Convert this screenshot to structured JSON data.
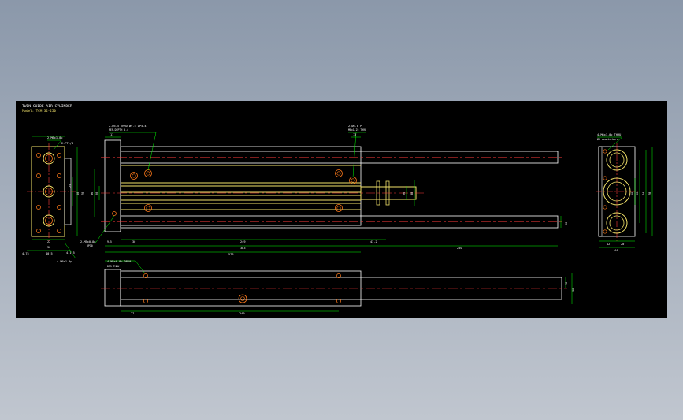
{
  "title_block": {
    "line1": "TWIN GUIDE AIR CYLINDER",
    "line2": "Model: TCM 32-250"
  },
  "colors": {
    "background": "#000000",
    "outline": "#ffffff",
    "body": "#f2e26a",
    "dimension": "#00ff00",
    "centerline": "#ff3b3b",
    "leader": "#00ff00",
    "hole": "#ff7a1a"
  },
  "left_view": {
    "top_callout": "2-M6x1.0p",
    "dims": [
      "22",
      "30",
      "40.5",
      "4-1.5",
      "50",
      "25",
      "70",
      "2-PT1/8",
      "4-M6x1.0p"
    ],
    "bottom_left": "4.75",
    "bottom_callout": "4-M6x1.0p"
  },
  "front_view": {
    "top_dims": [
      "17",
      "13"
    ],
    "left_callout_1": "2-Ø5.5 THRU Ø9.5 DP5.4",
    "left_callout_2": "REF.DEPTH 5.4",
    "right_callout_1": "2-Ø6.8 P",
    "right_callout_2": "M8x1.25 THRU",
    "side_dims": [
      "36",
      "20",
      "22"
    ],
    "rod_dims": [
      "26",
      "38"
    ],
    "bottom_dims": [
      "30",
      "249",
      "43.2",
      "383",
      "576",
      "250"
    ],
    "left_bottom_callout": "2-M5x0.8p",
    "left_bottom_sub": "DP10",
    "left_small": "9.5",
    "tail_dim": "20"
  },
  "right_view": {
    "top_callout": "4-M6x1.0p THRU",
    "sub_callout": "Ø8 counterbore",
    "side_dims": [
      "60",
      "74",
      "50",
      "78"
    ],
    "bottom_dims": [
      "12",
      "20",
      "44"
    ]
  },
  "bottom_view": {
    "callout_1": "4-M5x0.8p DP10",
    "callout_2": "DP5 THRU",
    "dims": [
      "27",
      "249"
    ],
    "right_dims": [
      "18",
      "38"
    ]
  }
}
